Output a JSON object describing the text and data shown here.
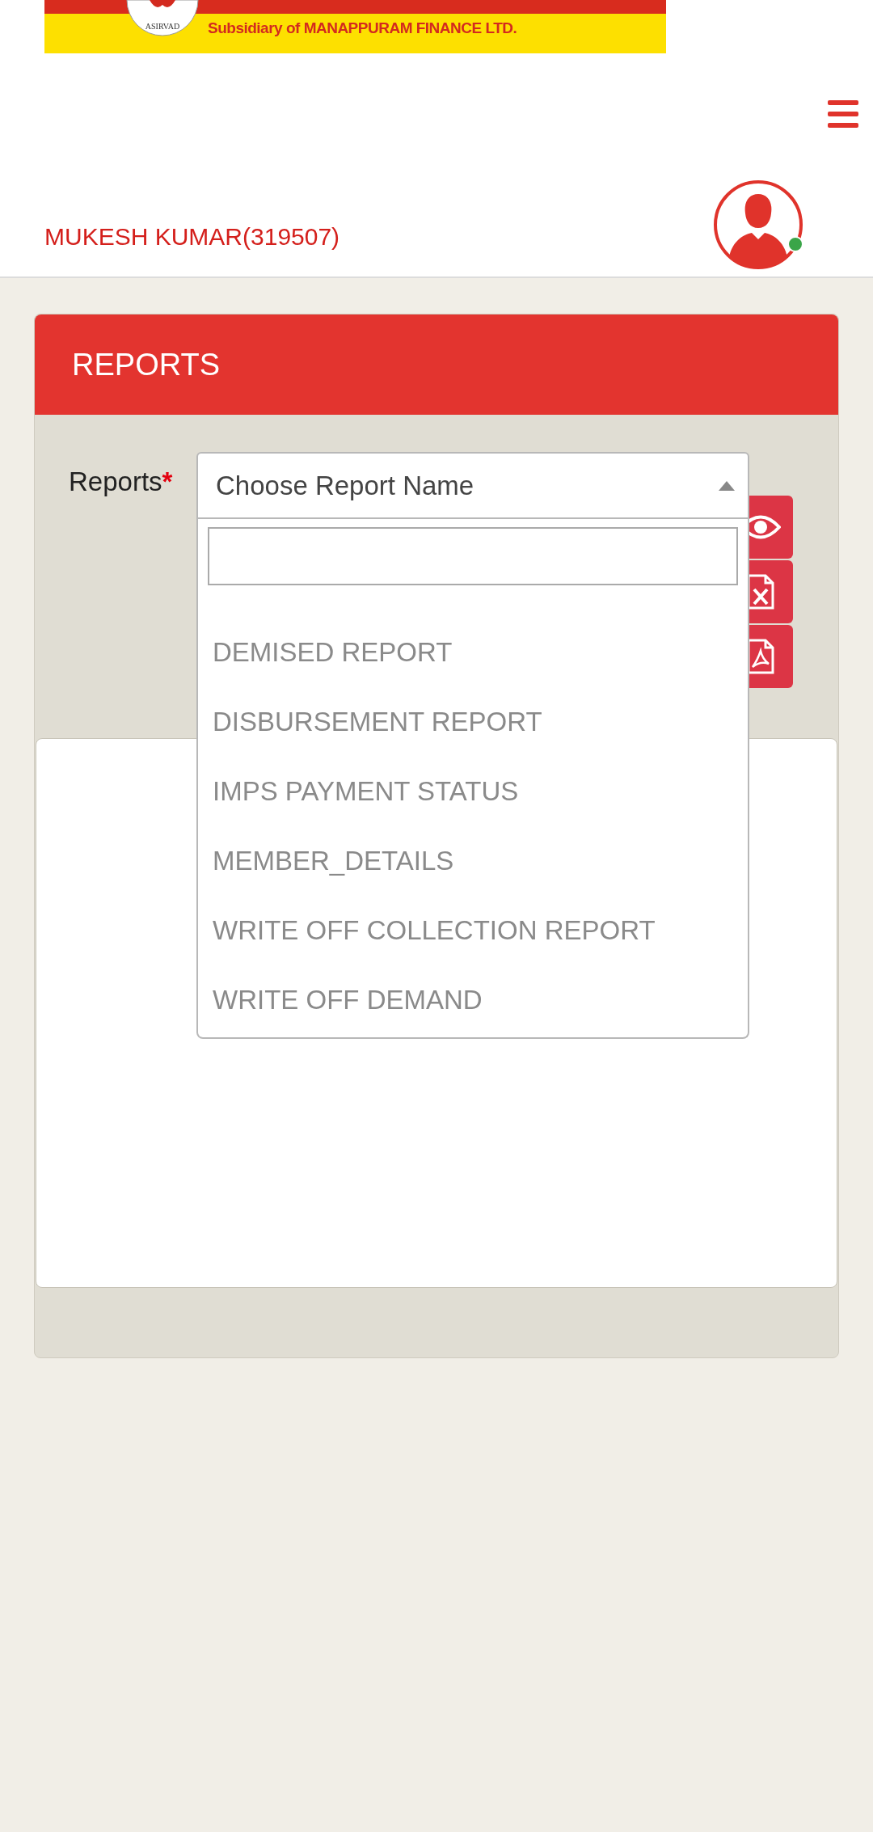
{
  "banner": {
    "logo_text": "ASIRVAD",
    "tagline": "Subsidiary of MANAPPURAM FINANCE LTD."
  },
  "header": {
    "user": "MUKESH KUMAR(319507)",
    "online": true
  },
  "panel": {
    "title": "REPORTS",
    "field_label": "Reports",
    "required_mark": "*",
    "select": {
      "placeholder": "Choose Report Name",
      "expanded": true
    },
    "options": [
      {
        "label": "DEMISED REPORT",
        "selected": false
      },
      {
        "label": "DISBURSEMENT REPORT",
        "selected": false
      },
      {
        "label": "IMPS PAYMENT STATUS",
        "selected": false
      },
      {
        "label": "MEMBER_DETAILS",
        "selected": false
      },
      {
        "label": "WRITE OFF COLLECTION REPORT",
        "selected": false
      },
      {
        "label": "WRITE OFF DEMAND",
        "selected": false
      }
    ],
    "actions": [
      {
        "kind": "view"
      },
      {
        "kind": "excel"
      },
      {
        "kind": "pdf"
      }
    ]
  }
}
